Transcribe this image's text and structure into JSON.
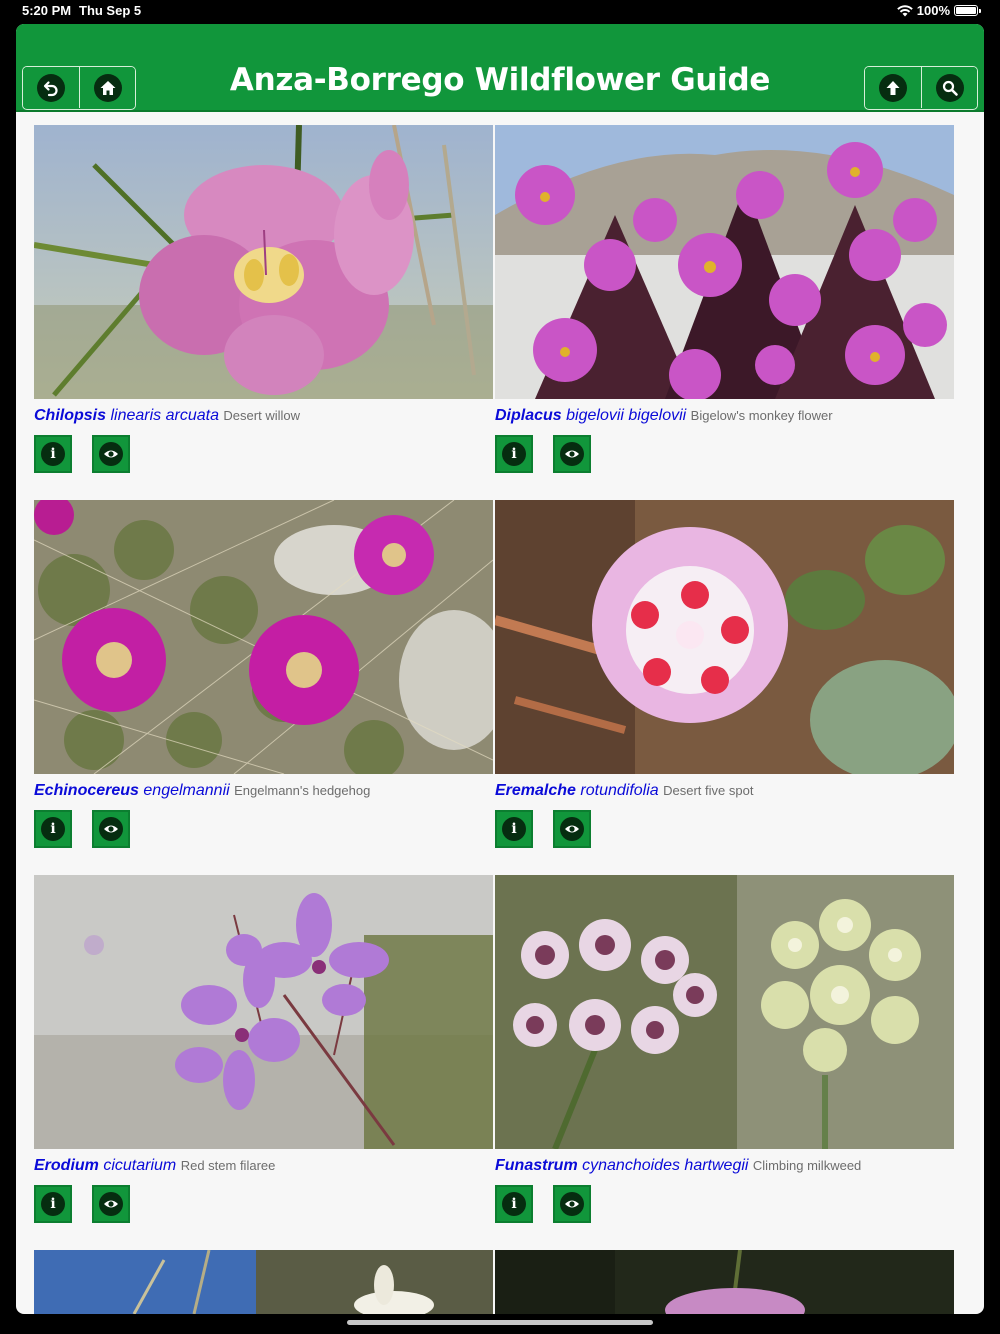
{
  "status": {
    "time": "5:20 PM",
    "date": "Thu Sep 5",
    "battery": "100%"
  },
  "header": {
    "title": "Anza-Borrego Wildflower Guide",
    "buttons": {
      "back": "back-icon",
      "home": "home-icon",
      "up": "arrow-up-icon",
      "search": "search-icon"
    }
  },
  "colors": {
    "header": "#11963b",
    "genus": "#0b0bd8",
    "common": "#6d6d6d"
  },
  "entries": [
    {
      "genus": "Chilopsis",
      "species": "linearis arcuata",
      "common": "Desert willow"
    },
    {
      "genus": "Diplacus",
      "species": "bigelovii bigelovii",
      "common": "Bigelow's monkey flower"
    },
    {
      "genus": "Echinocereus",
      "species": "engelmannii",
      "common": "Engelmann's hedgehog"
    },
    {
      "genus": "Eremalche",
      "species": "rotundifolia",
      "common": "Desert five spot"
    },
    {
      "genus": "Erodium",
      "species": "cicutarium",
      "common": "Red stem filaree"
    },
    {
      "genus": "Funastrum",
      "species": "cynanchoides hartwegii",
      "common": "Climbing milkweed"
    }
  ],
  "actions": {
    "info_icon": "info-icon",
    "view_icon": "eye-icon",
    "info_glyph": "i"
  }
}
